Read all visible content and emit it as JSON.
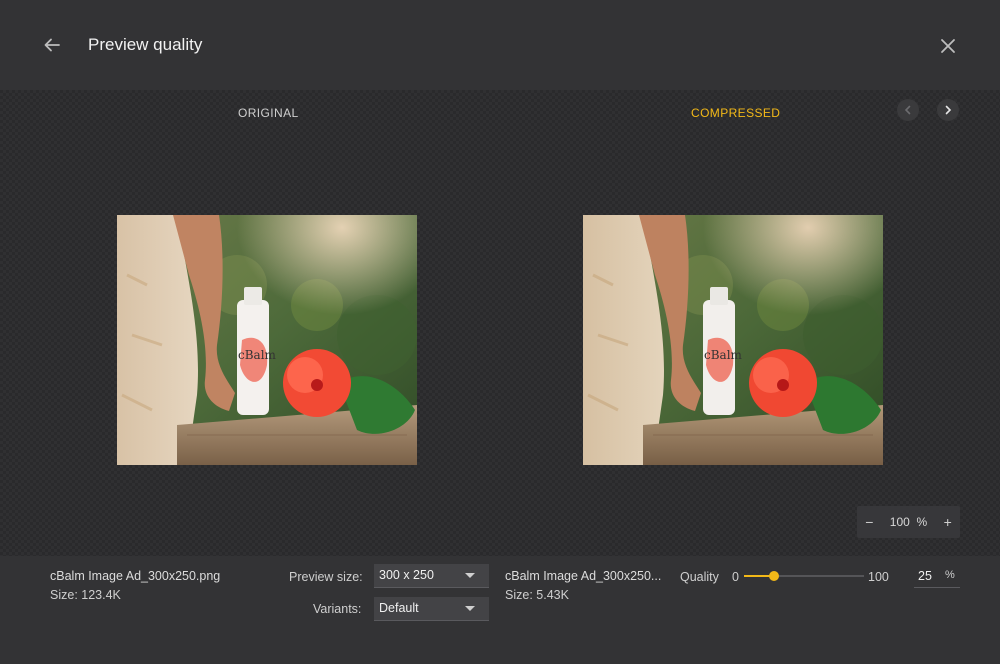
{
  "header": {
    "title": "Preview quality"
  },
  "stage": {
    "original_label": "ORIGINAL",
    "compressed_label": "COMPRESSED",
    "zoom": {
      "minus": "−",
      "value": "100",
      "unit": "%",
      "plus": "+"
    }
  },
  "original": {
    "filename": "cBalm Image Ad_300x250.png",
    "size_label": "Size:",
    "size_value": "123.4K",
    "product_text": "cBalm"
  },
  "compressed": {
    "filename": "cBalm Image Ad_300x250...",
    "size_label": "Size:",
    "size_value": "5.43K",
    "product_text": "cBalm"
  },
  "controls": {
    "preview_size_label": "Preview size:",
    "preview_size_value": "300 x 250",
    "variants_label": "Variants:",
    "variants_value": "Default",
    "quality_label": "Quality",
    "quality_min": "0",
    "quality_max": "100",
    "quality_value": "25",
    "quality_unit": "%",
    "quality_fraction": 0.25
  },
  "colors": {
    "accent": "#f3b918"
  }
}
